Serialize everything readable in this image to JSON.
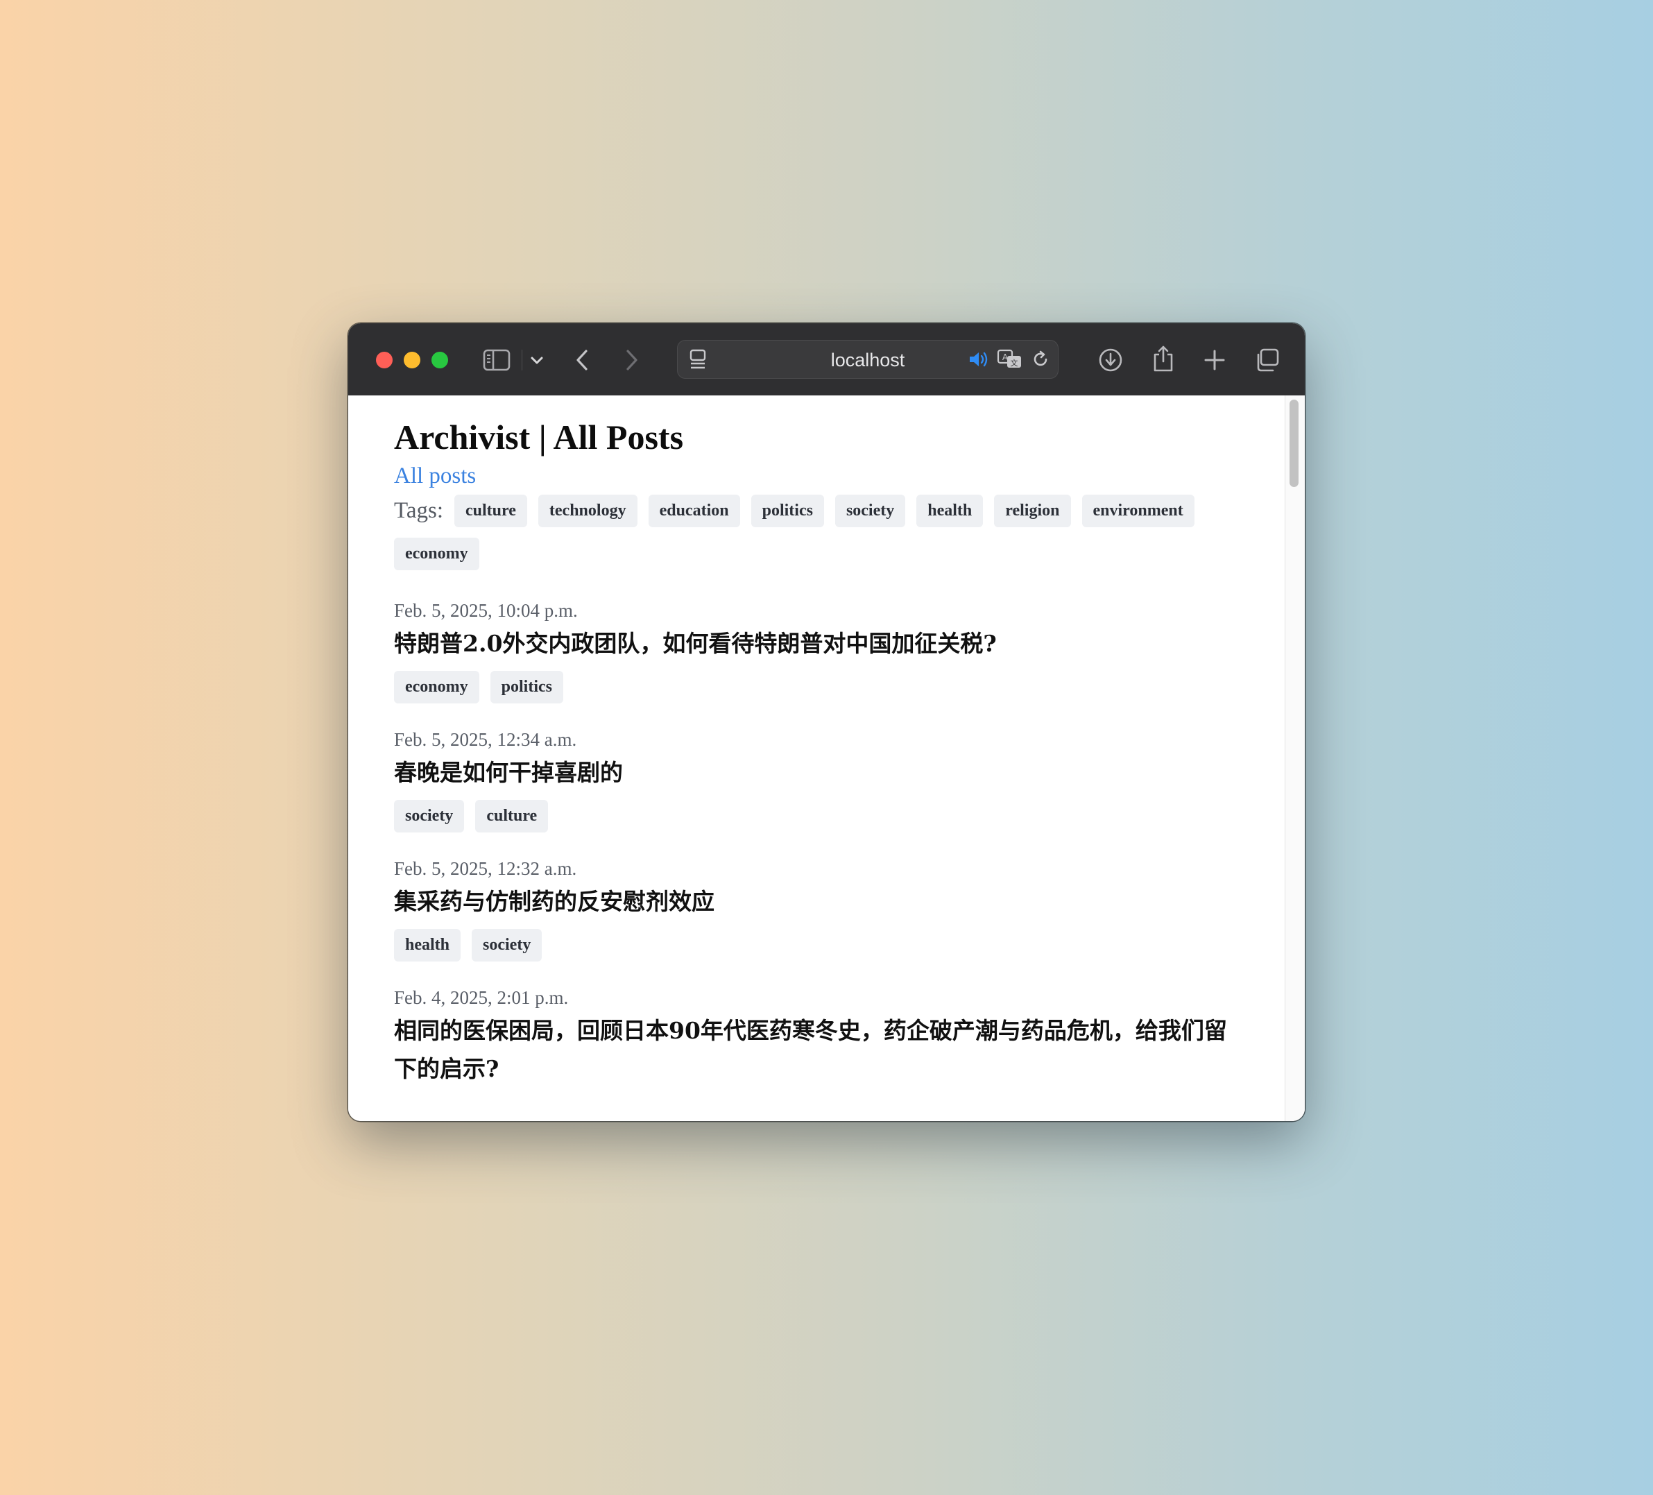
{
  "browser": {
    "url": "localhost"
  },
  "page": {
    "title": "Archivist | All Posts",
    "all_posts_link": "All posts",
    "tags_label": "Tags:",
    "tags": [
      "culture",
      "technology",
      "education",
      "politics",
      "society",
      "health",
      "religion",
      "environment",
      "economy"
    ]
  },
  "posts": [
    {
      "date": "Feb. 5, 2025, 10:04 p.m.",
      "title": "特朗普2.0外交内政团队，如何看待特朗普对中国加征关税?",
      "tags": [
        "economy",
        "politics"
      ]
    },
    {
      "date": "Feb. 5, 2025, 12:34 a.m.",
      "title": "春晚是如何干掉喜剧的",
      "tags": [
        "society",
        "culture"
      ]
    },
    {
      "date": "Feb. 5, 2025, 12:32 a.m.",
      "title": "集采药与仿制药的反安慰剂效应",
      "tags": [
        "health",
        "society"
      ]
    },
    {
      "date": "Feb. 4, 2025, 2:01 p.m.",
      "title": "相同的医保困局，回顾日本90年代医药寒冬史，药企破产潮与药品危机，给我们留下的启示?",
      "tags": []
    }
  ]
}
